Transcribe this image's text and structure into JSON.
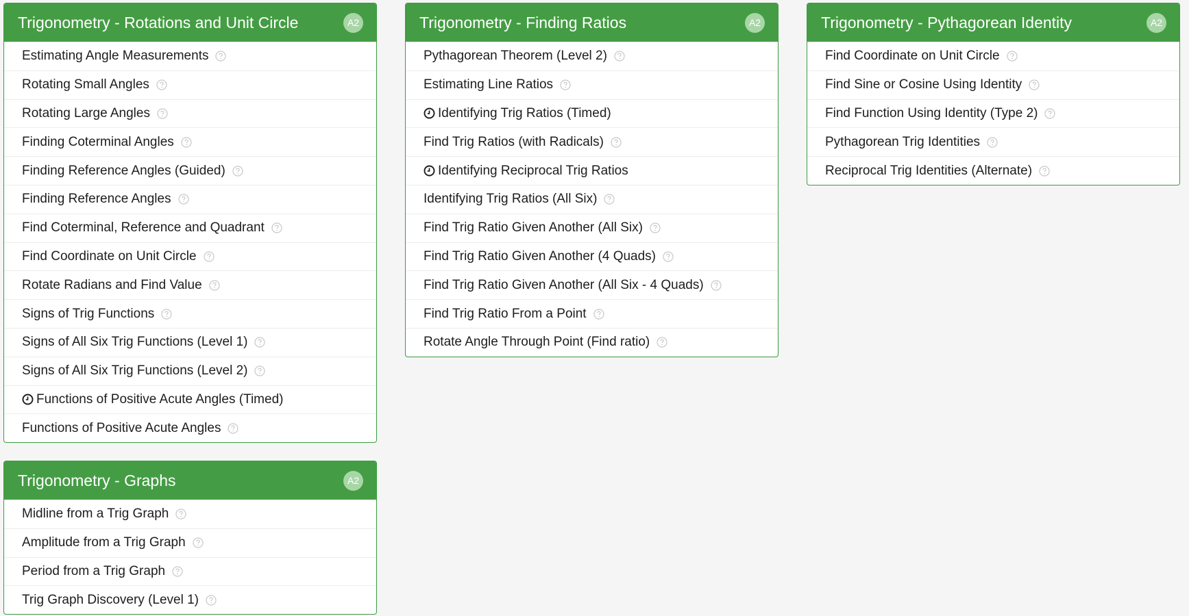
{
  "panels": [
    {
      "title": "Trigonometry - Rotations and Unit Circle",
      "badge": "A2",
      "items": [
        {
          "label": "Estimating Angle Measurements",
          "timed": false,
          "help": true
        },
        {
          "label": "Rotating Small Angles",
          "timed": false,
          "help": true
        },
        {
          "label": "Rotating Large Angles",
          "timed": false,
          "help": true
        },
        {
          "label": "Finding Coterminal Angles",
          "timed": false,
          "help": true
        },
        {
          "label": "Finding Reference Angles (Guided)",
          "timed": false,
          "help": true
        },
        {
          "label": "Finding Reference Angles",
          "timed": false,
          "help": true
        },
        {
          "label": "Find Coterminal, Reference and Quadrant",
          "timed": false,
          "help": true
        },
        {
          "label": "Find Coordinate on Unit Circle",
          "timed": false,
          "help": true
        },
        {
          "label": "Rotate Radians and Find Value",
          "timed": false,
          "help": true
        },
        {
          "label": "Signs of Trig Functions",
          "timed": false,
          "help": true
        },
        {
          "label": "Signs of All Six Trig Functions (Level 1)",
          "timed": false,
          "help": true
        },
        {
          "label": "Signs of All Six Trig Functions (Level 2)",
          "timed": false,
          "help": true
        },
        {
          "label": "Functions of Positive Acute Angles (Timed)",
          "timed": true,
          "help": false
        },
        {
          "label": "Functions of Positive Acute Angles",
          "timed": false,
          "help": true
        }
      ]
    },
    {
      "title": "Trigonometry - Finding Ratios",
      "badge": "A2",
      "items": [
        {
          "label": "Pythagorean Theorem (Level 2)",
          "timed": false,
          "help": true
        },
        {
          "label": "Estimating Line Ratios",
          "timed": false,
          "help": true
        },
        {
          "label": "Identifying Trig Ratios (Timed)",
          "timed": true,
          "help": false
        },
        {
          "label": "Find Trig Ratios (with Radicals)",
          "timed": false,
          "help": true
        },
        {
          "label": "Identifying Reciprocal Trig Ratios",
          "timed": true,
          "help": false
        },
        {
          "label": "Identifying Trig Ratios (All Six)",
          "timed": false,
          "help": true
        },
        {
          "label": "Find Trig Ratio Given Another (All Six)",
          "timed": false,
          "help": true
        },
        {
          "label": "Find Trig Ratio Given Another (4 Quads)",
          "timed": false,
          "help": true
        },
        {
          "label": "Find Trig Ratio Given Another (All Six - 4 Quads)",
          "timed": false,
          "help": true
        },
        {
          "label": "Find Trig Ratio From a Point",
          "timed": false,
          "help": true
        },
        {
          "label": "Rotate Angle Through Point (Find ratio)",
          "timed": false,
          "help": true
        }
      ]
    },
    {
      "title": "Trigonometry - Pythagorean Identity",
      "badge": "A2",
      "items": [
        {
          "label": "Find Coordinate on Unit Circle",
          "timed": false,
          "help": true
        },
        {
          "label": "Find Sine or Cosine Using Identity",
          "timed": false,
          "help": true
        },
        {
          "label": "Find Function Using Identity (Type 2)",
          "timed": false,
          "help": true
        },
        {
          "label": "Pythagorean Trig Identities",
          "timed": false,
          "help": true
        },
        {
          "label": "Reciprocal Trig Identities (Alternate)",
          "timed": false,
          "help": true
        }
      ]
    },
    {
      "title": "Trigonometry - Graphs",
      "badge": "A2",
      "items": [
        {
          "label": "Midline from a Trig Graph",
          "timed": false,
          "help": true
        },
        {
          "label": "Amplitude from a Trig Graph",
          "timed": false,
          "help": true
        },
        {
          "label": "Period from a Trig Graph",
          "timed": false,
          "help": true
        },
        {
          "label": "Trig Graph Discovery (Level 1)",
          "timed": false,
          "help": true
        }
      ]
    }
  ],
  "icons": {
    "help": "question-circle-icon",
    "timer": "clock-icon"
  },
  "colors": {
    "header": "#449d44",
    "badge": "#a9d6a7",
    "border": "#3c9a3f",
    "text": "#1d1d1d",
    "help_icon": "#c8c8c8"
  }
}
